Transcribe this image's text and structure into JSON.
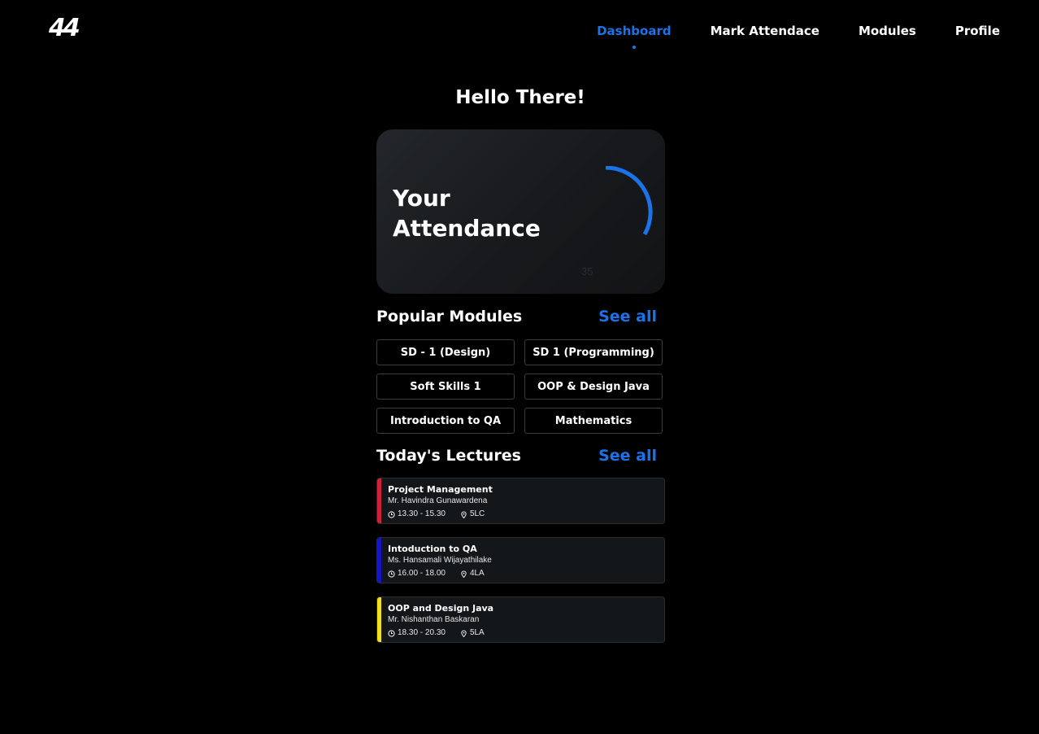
{
  "header": {
    "logo_text": "44",
    "nav": [
      {
        "label": "Dashboard"
      },
      {
        "label": "Mark Attendace"
      },
      {
        "label": "Modules"
      },
      {
        "label": "Profile"
      }
    ]
  },
  "greeting": "Hello There!",
  "attendance": {
    "title": "Your Attendance",
    "count": "35",
    "ring_color": "#1a73e8"
  },
  "popular_modules": {
    "title": "Popular Modules",
    "see_all": "See all",
    "items": [
      "SD - 1 (Design)",
      "SD 1 (Programming)",
      "Soft Skills 1",
      "OOP & Design Java",
      "Introduction to QA",
      "Mathematics"
    ]
  },
  "todays_lectures": {
    "title": "Today's Lectures",
    "see_all": "See all",
    "items": [
      {
        "title": "Project Management",
        "teacher": "Mr. Havindra Gunawardena",
        "time": "13.30 - 15.30",
        "room": "5LC",
        "color": "#d0203a"
      },
      {
        "title": "Intoduction to QA",
        "teacher": "Ms. Hansamali Wijayathilake",
        "time": "16.00 - 18.00",
        "room": "4LA",
        "color": "#1414c8"
      },
      {
        "title": "OOP and Design Java",
        "teacher": "Mr. Nishanthan Baskaran",
        "time": "18.30 - 20.30",
        "room": "5LA",
        "color": "#f0e020"
      }
    ]
  },
  "icons": {
    "time": "clock-icon",
    "room": "location-pin-icon"
  },
  "colors": {
    "accent": "#1a73e8",
    "background": "#000000"
  }
}
